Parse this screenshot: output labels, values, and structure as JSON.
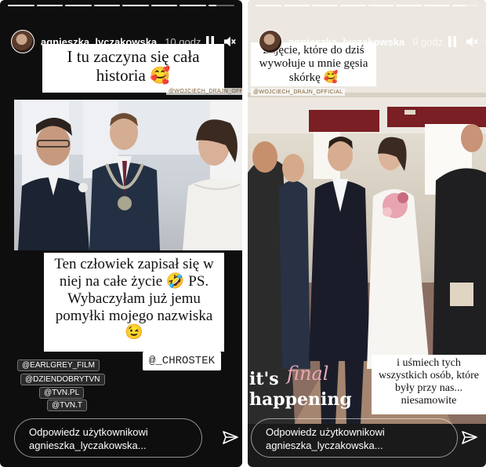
{
  "stories": [
    {
      "user": {
        "username": "agnieszka_lyczakowska",
        "time": "10 godz."
      },
      "progress": [
        1,
        1,
        1,
        1,
        1,
        1,
        1,
        0.3
      ],
      "captions": {
        "top": "I tu zaczyna się cała historia 🥰",
        "middle": "Ten człowiek zapisał się w niej na całe życie 🤣 PS. Wybaczyłam już jemu pomyłki mojego nazwiska 😉"
      },
      "photo_tag": "@WOJCIECH_DRAJN_OFFICIAL",
      "handle": "@_CHROSTEK",
      "mentions": [
        "@EARLGREY_FILM",
        "@DZIENDOBRYTVN",
        "@TVN.PL",
        "@TVN.T"
      ],
      "reply_placeholder": "Odpowiedz użytkownikowi agnieszka_lyczakowska..."
    },
    {
      "user": {
        "username": "agnieszka_lyczakowska",
        "time": "9 godz."
      },
      "progress": [
        1,
        1,
        1,
        1,
        1,
        1,
        1,
        0.5
      ],
      "captions": {
        "top": "Zajęcie, które do dziś wywołuje u mnie gęsia skórkę 🥰",
        "bottom": "i uśmiech tych wszystkich osób, które były przy nas... niesamowite"
      },
      "photo_tag": "@WOJCIECH_DRAJN_OFFICIAL",
      "overlay": {
        "line1": "it's",
        "script": "final",
        "line2": "happening"
      },
      "reply_placeholder": "Odpowiedz użytkownikowi agnieszka_lyczakowska..."
    }
  ],
  "icons": [
    "pause-icon",
    "mute-icon",
    "more-icon",
    "send-icon"
  ]
}
